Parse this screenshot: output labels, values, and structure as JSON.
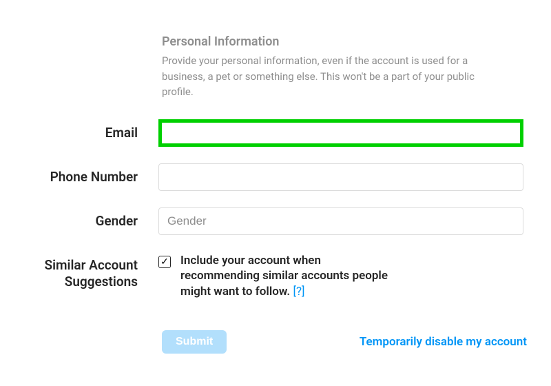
{
  "section": {
    "title": "Personal Information",
    "description": "Provide your personal information, even if the account is used for a business, a pet or something else. This won't be a part of your public profile."
  },
  "fields": {
    "email": {
      "label": "Email",
      "value": ""
    },
    "phone": {
      "label": "Phone Number",
      "value": ""
    },
    "gender": {
      "label": "Gender",
      "placeholder": "Gender",
      "value": ""
    },
    "similar": {
      "label": "Similar Account Suggestions",
      "checkbox_label": "Include your account when recommending similar accounts people might want to follow.",
      "help": "[?]",
      "checked": true
    }
  },
  "actions": {
    "submit": "Submit",
    "disable_link": "Temporarily disable my account"
  }
}
